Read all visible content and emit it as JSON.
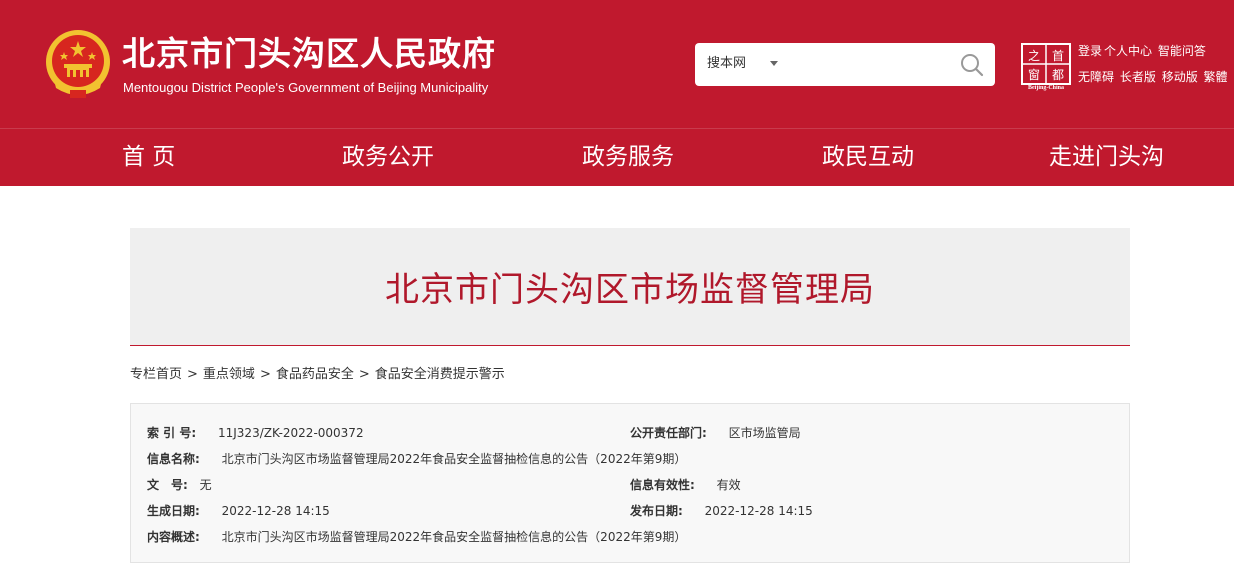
{
  "header": {
    "title": "北京市门头沟区人民政府",
    "subtitle": "Mentougou District People's Government of Beijing Municipality",
    "search": {
      "scope": "搜本网",
      "placeholder": ""
    },
    "capital_logo": {
      "chars": [
        "之",
        "首",
        "窗",
        "都"
      ],
      "caption": "Beijing-China"
    },
    "links_row1": [
      "登录",
      "个人中心",
      "智能问答"
    ],
    "links_row2": [
      "无障碍",
      "长者版",
      "移动版",
      "繁體"
    ]
  },
  "nav": {
    "items": [
      "首 页",
      "政务公开",
      "政务服务",
      "政民互动",
      "走进门头沟"
    ]
  },
  "banner": {
    "title": "北京市门头沟区市场监督管理局"
  },
  "breadcrumb": [
    "专栏首页",
    "重点领域",
    "食品药品安全",
    "食品安全消费提示警示"
  ],
  "breadcrumb_sep": ">",
  "info": {
    "index_label": "索 引 号:",
    "index_value": "11J323/ZK-2022-000372",
    "dept_label": "公开责任部门:",
    "dept_value": "区市场监管局",
    "name_label": "信息名称:",
    "name_value": "北京市门头沟区市场监督管理局2022年食品安全监督抽检信息的公告（2022年第9期）",
    "docno_label": "文　号:",
    "docno_value": "无",
    "validity_label": "信息有效性:",
    "validity_value": "有效",
    "created_label": "生成日期:",
    "created_value": "2022-12-28 14:15",
    "published_label": "发布日期:",
    "published_value": "2022-12-28 14:15",
    "summary_label": "内容概述:",
    "summary_value": "北京市门头沟区市场监督管理局2022年食品安全监督抽检信息的公告（2022年第9期）"
  },
  "colors": {
    "brand_red": "#c0192e",
    "banner_bg": "#efefef",
    "title_red": "#b0182b",
    "emblem_gold": "#f2c230"
  }
}
